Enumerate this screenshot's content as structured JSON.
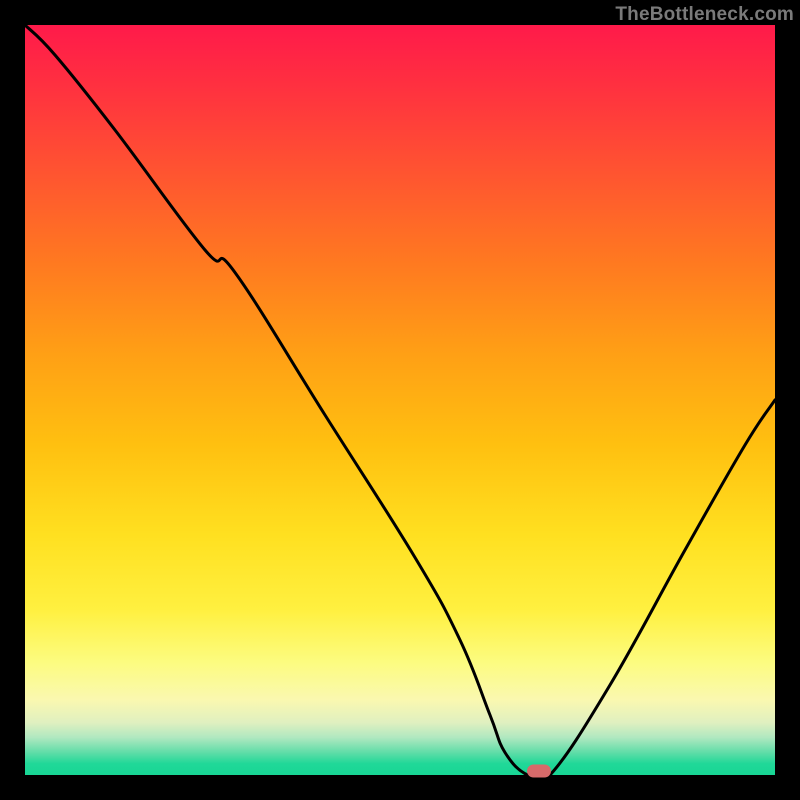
{
  "watermark": "TheBottleneck.com",
  "colors": {
    "background": "#000000",
    "gradient_top": "#ff1a4a",
    "gradient_mid": "#ffe020",
    "gradient_bottom": "#18d695",
    "curve": "#000000",
    "marker": "#d66a6a"
  },
  "chart_data": {
    "type": "line",
    "title": "",
    "xlabel": "",
    "ylabel": "",
    "xlim": [
      0,
      100
    ],
    "ylim": [
      0,
      100
    ],
    "series": [
      {
        "name": "bottleneck-curve",
        "x": [
          0,
          4,
          12,
          24,
          28,
          40,
          52,
          58,
          62,
          64,
          67,
          70,
          78,
          88,
          96,
          100
        ],
        "values": [
          100,
          96,
          86,
          70,
          67,
          48,
          29,
          18,
          8,
          3,
          0,
          0,
          12,
          30,
          44,
          50
        ]
      }
    ],
    "annotations": [
      {
        "name": "optimal-marker",
        "x": 68.5,
        "y": 0.5
      }
    ]
  }
}
